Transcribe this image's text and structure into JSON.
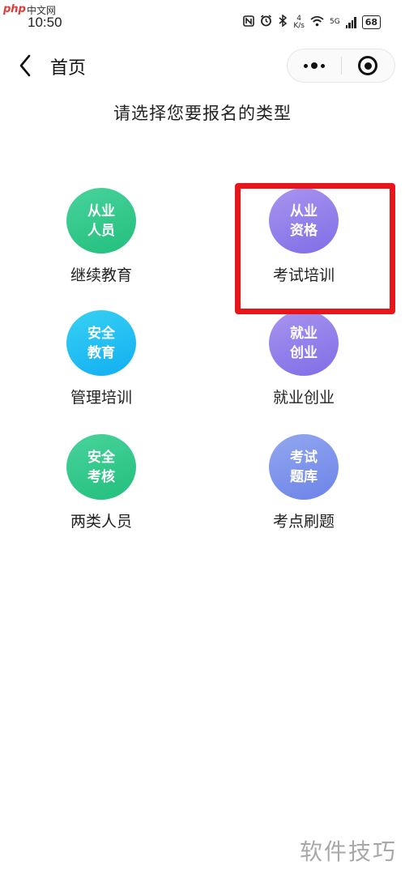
{
  "status_bar": {
    "overlay_logo": "php",
    "overlay_site": "中文网",
    "time": "10:50",
    "net_speed_top": "4",
    "net_speed_bottom": "K/s",
    "network_type": "5G",
    "battery": "68"
  },
  "nav": {
    "title": "首页",
    "back_icon": "chevron-left-icon",
    "more_icon": "more-dots-icon",
    "close_icon": "target-circle-icon"
  },
  "prompt": "请选择您要报名的类型",
  "items": [
    {
      "line1": "从业",
      "line2": "人员",
      "label": "继续教育",
      "color": "#2ec98a"
    },
    {
      "line1": "从业",
      "line2": "资格",
      "label": "考试培训",
      "color": "#8e7ceb"
    },
    {
      "line1": "安全",
      "line2": "教育",
      "label": "管理培训",
      "color": "#1ebdf3"
    },
    {
      "line1": "就业",
      "line2": "创业",
      "label": "就业创业",
      "color": "#8e7ceb"
    },
    {
      "line1": "安全",
      "line2": "考核",
      "label": "两类人员",
      "color": "#2ec98a"
    },
    {
      "line1": "考试",
      "line2": "题库",
      "label": "考点刷题",
      "color": "#7a90ea"
    }
  ],
  "highlight_color": "#e8161a",
  "watermark": "软件技巧"
}
